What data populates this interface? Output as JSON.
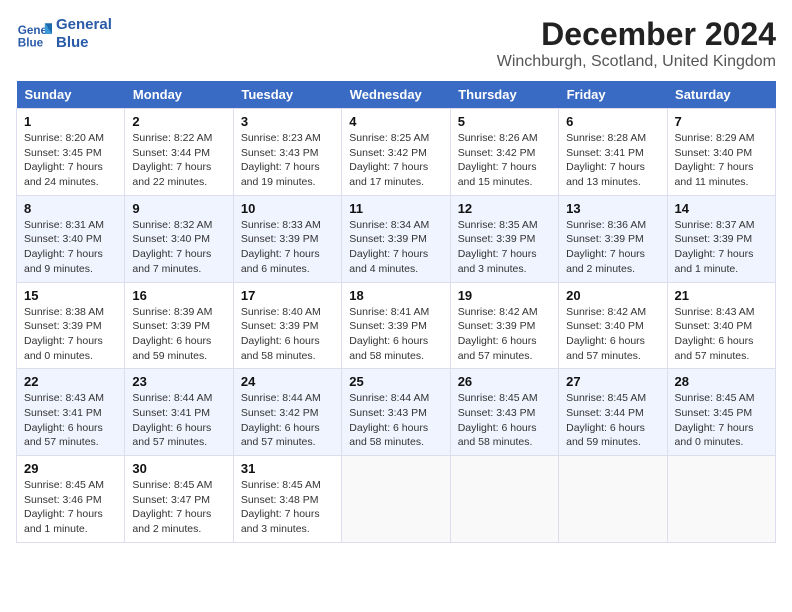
{
  "header": {
    "logo_line1": "General",
    "logo_line2": "Blue",
    "main_title": "December 2024",
    "subtitle": "Winchburgh, Scotland, United Kingdom"
  },
  "weekdays": [
    "Sunday",
    "Monday",
    "Tuesday",
    "Wednesday",
    "Thursday",
    "Friday",
    "Saturday"
  ],
  "weeks": [
    [
      {
        "day": "1",
        "sunrise": "8:20 AM",
        "sunset": "3:45 PM",
        "daylight": "7 hours and 24 minutes."
      },
      {
        "day": "2",
        "sunrise": "8:22 AM",
        "sunset": "3:44 PM",
        "daylight": "7 hours and 22 minutes."
      },
      {
        "day": "3",
        "sunrise": "8:23 AM",
        "sunset": "3:43 PM",
        "daylight": "7 hours and 19 minutes."
      },
      {
        "day": "4",
        "sunrise": "8:25 AM",
        "sunset": "3:42 PM",
        "daylight": "7 hours and 17 minutes."
      },
      {
        "day": "5",
        "sunrise": "8:26 AM",
        "sunset": "3:42 PM",
        "daylight": "7 hours and 15 minutes."
      },
      {
        "day": "6",
        "sunrise": "8:28 AM",
        "sunset": "3:41 PM",
        "daylight": "7 hours and 13 minutes."
      },
      {
        "day": "7",
        "sunrise": "8:29 AM",
        "sunset": "3:40 PM",
        "daylight": "7 hours and 11 minutes."
      }
    ],
    [
      {
        "day": "8",
        "sunrise": "8:31 AM",
        "sunset": "3:40 PM",
        "daylight": "7 hours and 9 minutes."
      },
      {
        "day": "9",
        "sunrise": "8:32 AM",
        "sunset": "3:40 PM",
        "daylight": "7 hours and 7 minutes."
      },
      {
        "day": "10",
        "sunrise": "8:33 AM",
        "sunset": "3:39 PM",
        "daylight": "7 hours and 6 minutes."
      },
      {
        "day": "11",
        "sunrise": "8:34 AM",
        "sunset": "3:39 PM",
        "daylight": "7 hours and 4 minutes."
      },
      {
        "day": "12",
        "sunrise": "8:35 AM",
        "sunset": "3:39 PM",
        "daylight": "7 hours and 3 minutes."
      },
      {
        "day": "13",
        "sunrise": "8:36 AM",
        "sunset": "3:39 PM",
        "daylight": "7 hours and 2 minutes."
      },
      {
        "day": "14",
        "sunrise": "8:37 AM",
        "sunset": "3:39 PM",
        "daylight": "7 hours and 1 minute."
      }
    ],
    [
      {
        "day": "15",
        "sunrise": "8:38 AM",
        "sunset": "3:39 PM",
        "daylight": "7 hours and 0 minutes."
      },
      {
        "day": "16",
        "sunrise": "8:39 AM",
        "sunset": "3:39 PM",
        "daylight": "6 hours and 59 minutes."
      },
      {
        "day": "17",
        "sunrise": "8:40 AM",
        "sunset": "3:39 PM",
        "daylight": "6 hours and 58 minutes."
      },
      {
        "day": "18",
        "sunrise": "8:41 AM",
        "sunset": "3:39 PM",
        "daylight": "6 hours and 58 minutes."
      },
      {
        "day": "19",
        "sunrise": "8:42 AM",
        "sunset": "3:39 PM",
        "daylight": "6 hours and 57 minutes."
      },
      {
        "day": "20",
        "sunrise": "8:42 AM",
        "sunset": "3:40 PM",
        "daylight": "6 hours and 57 minutes."
      },
      {
        "day": "21",
        "sunrise": "8:43 AM",
        "sunset": "3:40 PM",
        "daylight": "6 hours and 57 minutes."
      }
    ],
    [
      {
        "day": "22",
        "sunrise": "8:43 AM",
        "sunset": "3:41 PM",
        "daylight": "6 hours and 57 minutes."
      },
      {
        "day": "23",
        "sunrise": "8:44 AM",
        "sunset": "3:41 PM",
        "daylight": "6 hours and 57 minutes."
      },
      {
        "day": "24",
        "sunrise": "8:44 AM",
        "sunset": "3:42 PM",
        "daylight": "6 hours and 57 minutes."
      },
      {
        "day": "25",
        "sunrise": "8:44 AM",
        "sunset": "3:43 PM",
        "daylight": "6 hours and 58 minutes."
      },
      {
        "day": "26",
        "sunrise": "8:45 AM",
        "sunset": "3:43 PM",
        "daylight": "6 hours and 58 minutes."
      },
      {
        "day": "27",
        "sunrise": "8:45 AM",
        "sunset": "3:44 PM",
        "daylight": "6 hours and 59 minutes."
      },
      {
        "day": "28",
        "sunrise": "8:45 AM",
        "sunset": "3:45 PM",
        "daylight": "7 hours and 0 minutes."
      }
    ],
    [
      {
        "day": "29",
        "sunrise": "8:45 AM",
        "sunset": "3:46 PM",
        "daylight": "7 hours and 1 minute."
      },
      {
        "day": "30",
        "sunrise": "8:45 AM",
        "sunset": "3:47 PM",
        "daylight": "7 hours and 2 minutes."
      },
      {
        "day": "31",
        "sunrise": "8:45 AM",
        "sunset": "3:48 PM",
        "daylight": "7 hours and 3 minutes."
      },
      null,
      null,
      null,
      null
    ]
  ],
  "labels": {
    "sunrise": "Sunrise: ",
    "sunset": "Sunset: ",
    "daylight": "Daylight: "
  }
}
